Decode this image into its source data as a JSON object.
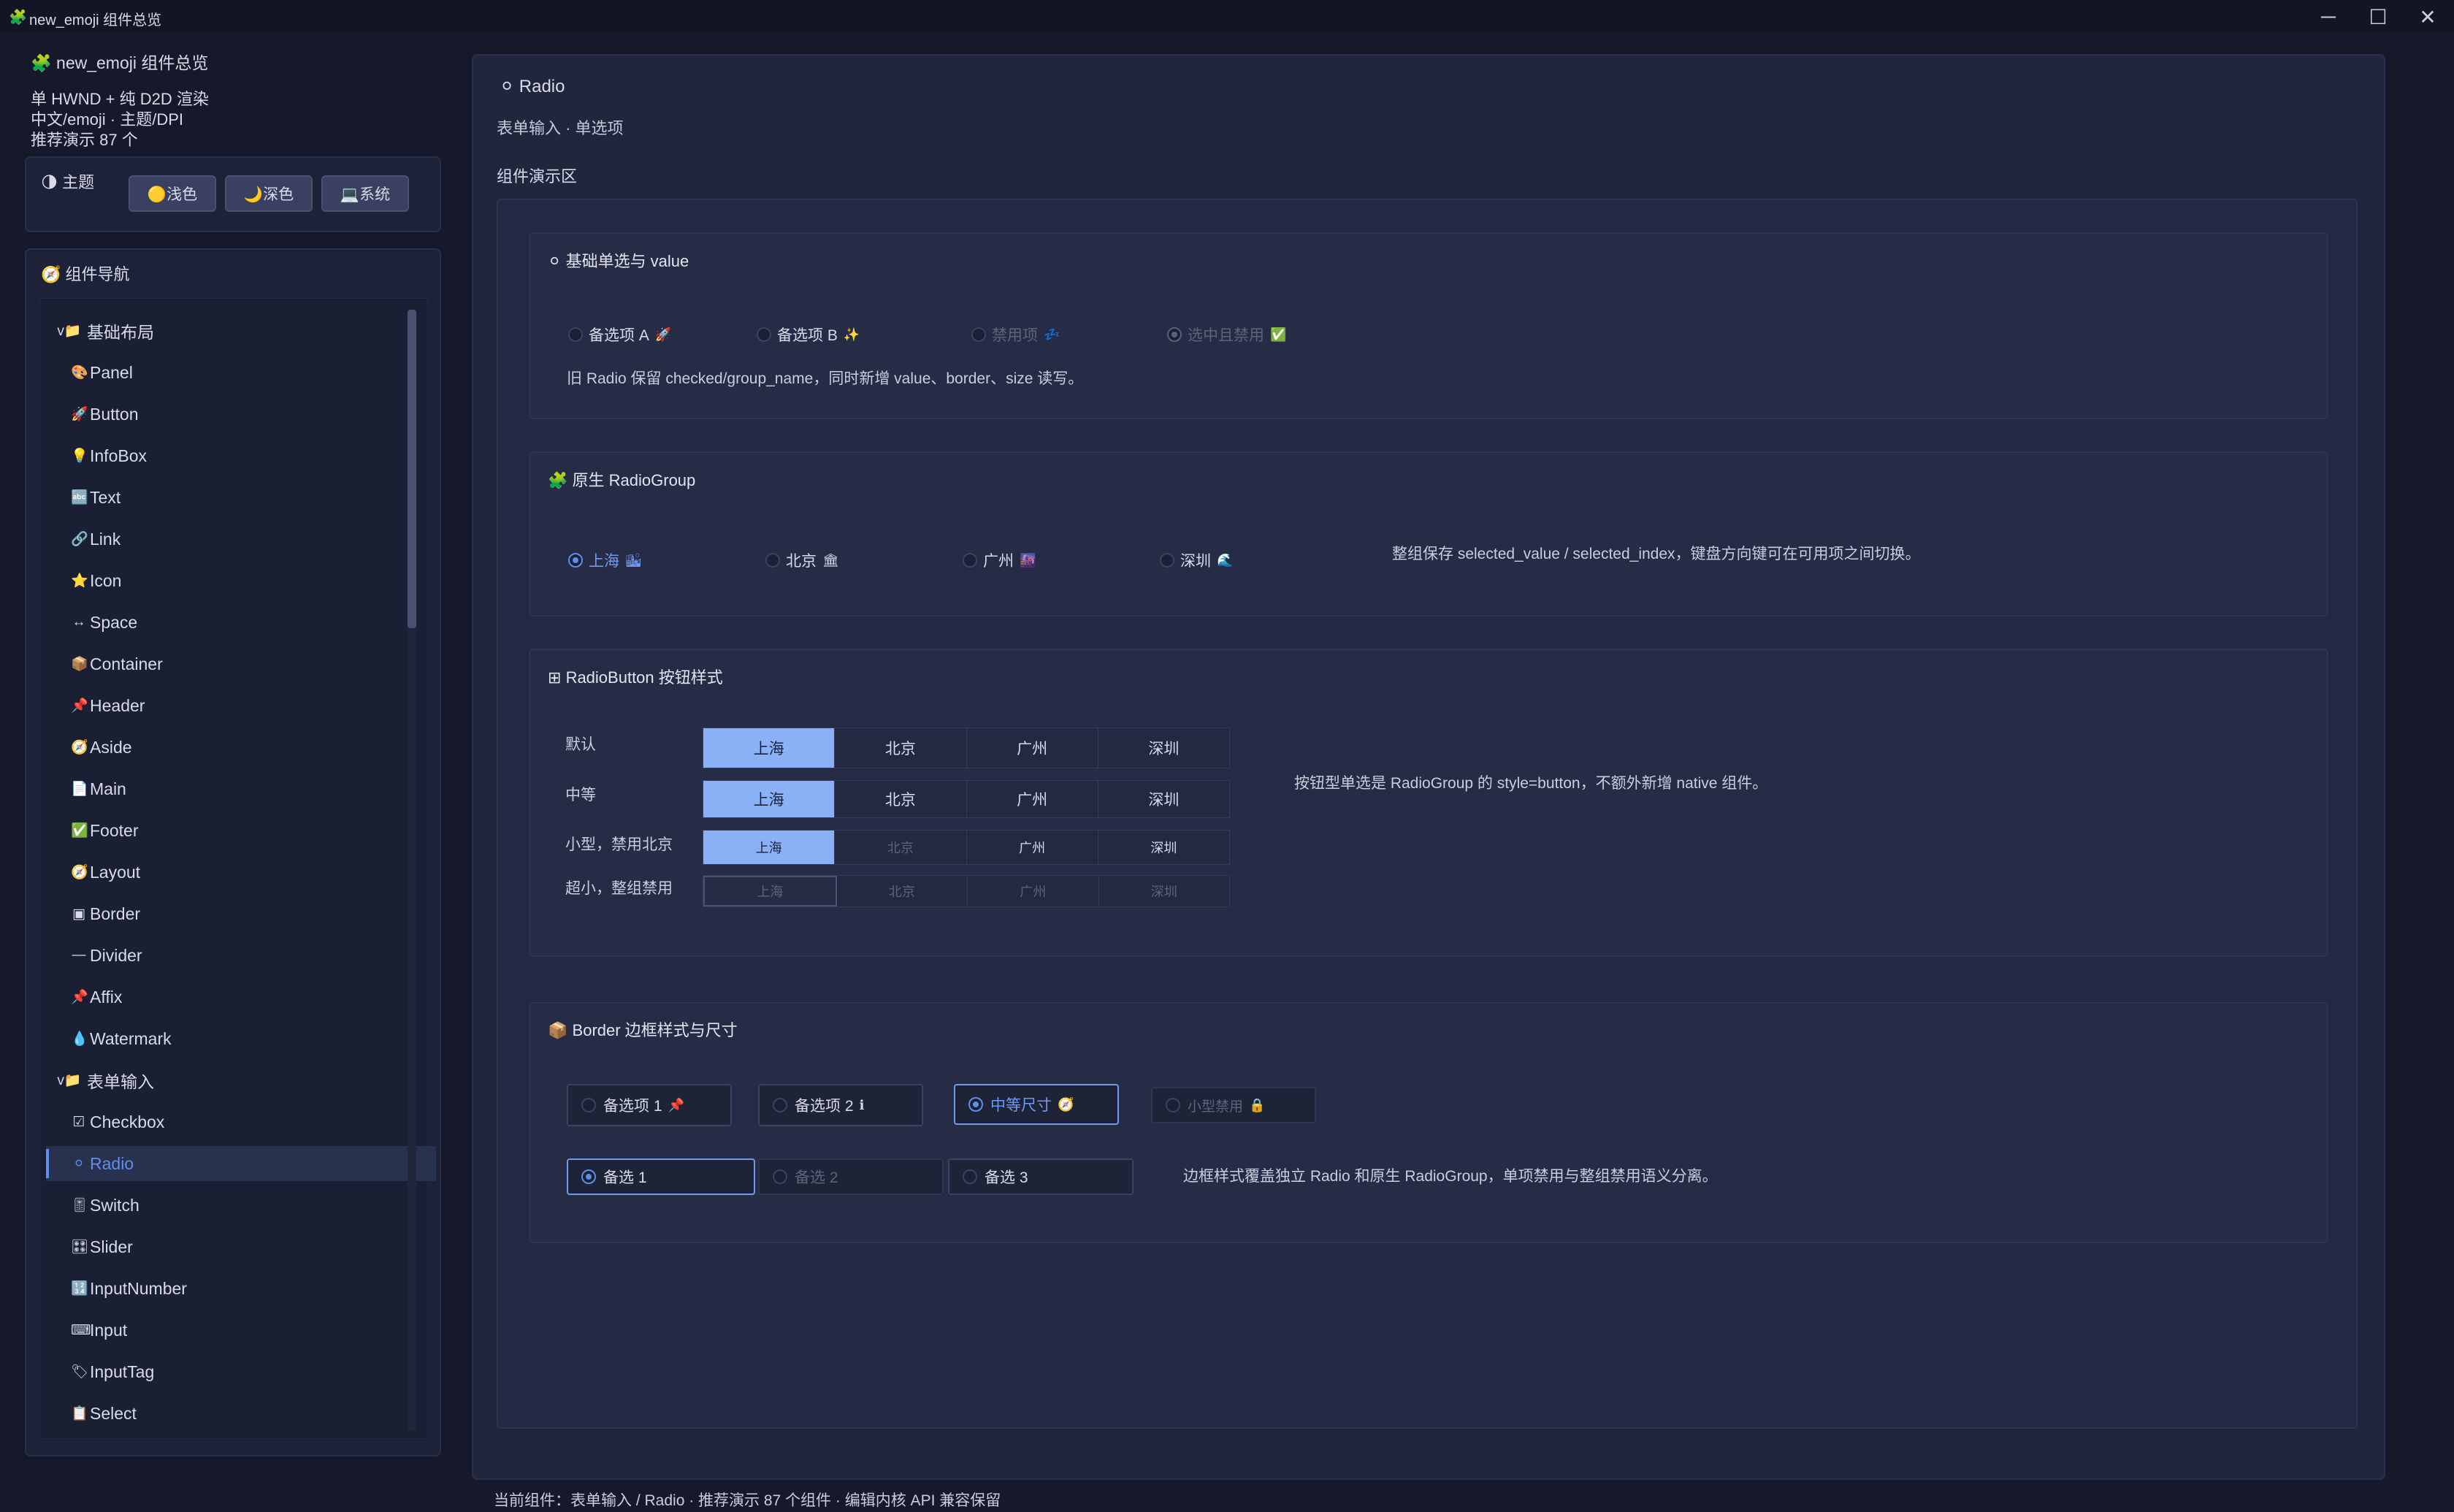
{
  "window": {
    "title": "new_emoji 组件总览",
    "icon": "🧩",
    "minimize": "─",
    "maximize": "☐",
    "close": "✕"
  },
  "sidebar": {
    "header_icon": "🧩",
    "header_title": "new_emoji 组件总览",
    "line1": "单 HWND + 纯 D2D 渲染",
    "line2": "中文/emoji · 主题/DPI",
    "line3": "推荐演示 87 个",
    "theme": {
      "icon": "🌗",
      "label": "主题",
      "light": "🟡浅色",
      "dark": "🌙深色",
      "system": "💻系统"
    },
    "nav_icon": "🧭",
    "nav_title": "组件导航",
    "items": [
      {
        "icon": "v📁",
        "label": "基础布局"
      },
      {
        "icon": "🎨",
        "label": "Panel"
      },
      {
        "icon": "🚀",
        "label": "Button"
      },
      {
        "icon": "💡",
        "label": "InfoBox"
      },
      {
        "icon": "🔤",
        "label": "Text"
      },
      {
        "icon": "🔗",
        "label": "Link"
      },
      {
        "icon": "⭐",
        "label": "Icon"
      },
      {
        "icon": "↔",
        "label": "Space"
      },
      {
        "icon": "📦",
        "label": "Container"
      },
      {
        "icon": "📌",
        "label": "Header"
      },
      {
        "icon": "🧭",
        "label": "Aside"
      },
      {
        "icon": "📄",
        "label": "Main"
      },
      {
        "icon": "✅",
        "label": "Footer"
      },
      {
        "icon": "🧭",
        "label": "Layout"
      },
      {
        "icon": "▣",
        "label": "Border"
      },
      {
        "icon": "—",
        "label": "Divider"
      },
      {
        "icon": "📌",
        "label": "Affix"
      },
      {
        "icon": "💧",
        "label": "Watermark"
      },
      {
        "icon": "v📁",
        "label": "表单输入"
      },
      {
        "icon": "☑",
        "label": "Checkbox"
      },
      {
        "icon": "⚪",
        "label": "Radio"
      },
      {
        "icon": "🎚",
        "label": "Switch"
      },
      {
        "icon": "🎛",
        "label": "Slider"
      },
      {
        "icon": "🔢",
        "label": "InputNumber"
      },
      {
        "icon": "⌨",
        "label": "Input"
      },
      {
        "icon": "🏷",
        "label": "InputTag"
      },
      {
        "icon": "📋",
        "label": "Select"
      }
    ]
  },
  "main": {
    "title_icon": "⚪",
    "title": "Radio",
    "subtitle": "表单输入 · 单选项",
    "demo_label": "组件演示区",
    "card1": {
      "icon": "⚪",
      "title": "基础单选与 value",
      "options": [
        {
          "label": "备选项 A",
          "emoji": "🚀"
        },
        {
          "label": "备选项 B",
          "emoji": "✨"
        },
        {
          "label": "禁用项",
          "emoji": "💤"
        },
        {
          "label": "选中且禁用",
          "emoji": "✅"
        }
      ],
      "note": "旧 Radio 保留 checked/group_name，同时新增 value、border、size 读写。"
    },
    "card2": {
      "icon": "🧩",
      "title": "原生 RadioGroup",
      "options": [
        {
          "label": "上海",
          "emoji": "🏙"
        },
        {
          "label": "北京",
          "emoji": "🏛"
        },
        {
          "label": "广州",
          "emoji": "🌆"
        },
        {
          "label": "深圳",
          "emoji": "🌊"
        }
      ],
      "note": "整组保存 selected_value / selected_index，键盘方向键可在可用项之间切换。"
    },
    "card3": {
      "icon": "⊞",
      "title": "RadioButton 按钮样式",
      "rows": [
        {
          "label": "默认",
          "options": [
            "上海",
            "北京",
            "广州",
            "深圳"
          ]
        },
        {
          "label": "中等",
          "options": [
            "上海",
            "北京",
            "广州",
            "深圳"
          ]
        },
        {
          "label": "小型，禁用北京",
          "options": [
            "上海",
            "北京",
            "广州",
            "深圳"
          ]
        },
        {
          "label": "超小，整组禁用",
          "options": [
            "上海",
            "北京",
            "广州",
            "深圳"
          ]
        }
      ],
      "note": "按钮型单选是 RadioGroup 的 style=button，不额外新增 native 组件。"
    },
    "card4": {
      "icon": "📦",
      "title": "Border 边框样式与尺寸",
      "row1": [
        {
          "label": "备选项 1",
          "emoji": "📌"
        },
        {
          "label": "备选项 2",
          "emoji": "ℹ"
        },
        {
          "label": "中等尺寸",
          "emoji": "🧭"
        },
        {
          "label": "小型禁用",
          "emoji": "🔒"
        }
      ],
      "row2": [
        {
          "label": "备选 1"
        },
        {
          "label": "备选 2"
        },
        {
          "label": "备选 3"
        }
      ],
      "note": "边框样式覆盖独立 Radio 和原生 RadioGroup，单项禁用与整组禁用语义分离。"
    }
  },
  "status": "当前组件：表单输入 / Radio · 推荐演示 87 个组件 · 编辑内核 API 兼容保留"
}
